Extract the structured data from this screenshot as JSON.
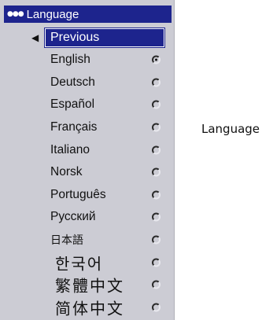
{
  "menu": {
    "title": "Language",
    "dots_icon": "three-dots-icon",
    "previous_label": "Previous",
    "back_icon": "left-triangle-icon",
    "languages": [
      {
        "label": "English",
        "selected": true
      },
      {
        "label": "Deutsch",
        "selected": false
      },
      {
        "label": "Español",
        "selected": false
      },
      {
        "label": "Français",
        "selected": false
      },
      {
        "label": "Italiano",
        "selected": false
      },
      {
        "label": "Norsk",
        "selected": false
      },
      {
        "label": "Português",
        "selected": false
      },
      {
        "label": "Русский",
        "selected": false
      },
      {
        "label": "日本語",
        "selected": false
      },
      {
        "label": "한국어",
        "selected": false
      },
      {
        "label": "繁體中文",
        "selected": false
      },
      {
        "label": "简体中文",
        "selected": false
      }
    ]
  },
  "caption": "Language",
  "colors": {
    "highlight": "#1d248d",
    "menu_bg": "#ccccd4"
  }
}
